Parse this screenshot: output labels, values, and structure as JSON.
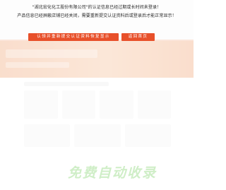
{
  "notice": {
    "line1": "\"湖北宏化化工股份有限公司\"的认证信息已经过期或长时间未登录！",
    "line2": "产品信息已经屏蔽店铺已经关闭，需要重新提交认证资料后或登录后才能正常显示！"
  },
  "buttons": {
    "reauth_label": "认领并重新提交认证资料恢复显示",
    "back_label": "返回首页"
  },
  "watermark": {
    "text": "免费自动收录"
  },
  "colors": {
    "accent": "#e8502a",
    "banner": "#f4bd98",
    "watermark": "#cfeec7"
  }
}
